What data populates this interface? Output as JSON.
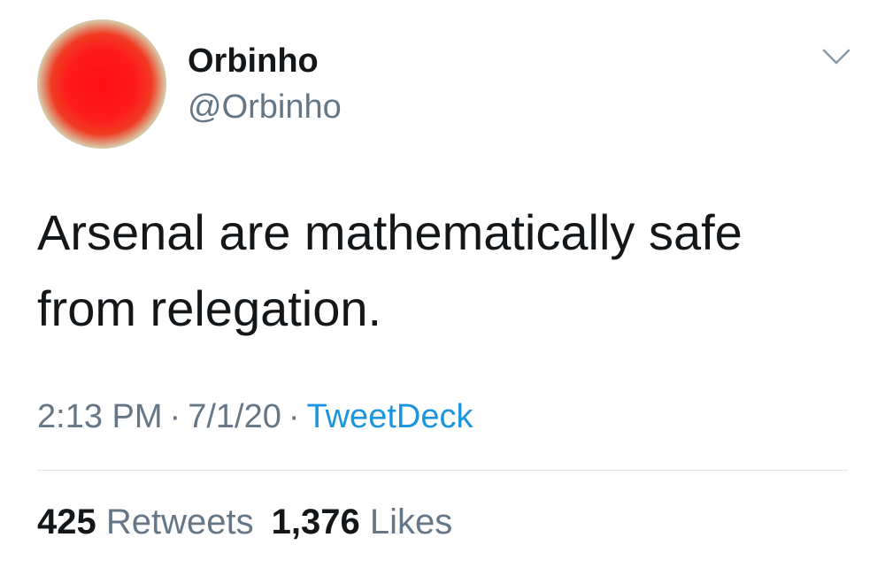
{
  "user": {
    "display_name": "Orbinho",
    "handle": "@Orbinho"
  },
  "tweet": {
    "text": "Arsenal are mathematically safe from relegation.",
    "time": "2:13 PM",
    "date": "7/1/20",
    "source": "TweetDeck",
    "separator": "·"
  },
  "stats": {
    "retweets_count": "425",
    "retweets_label": "Retweets",
    "likes_count": "1,376",
    "likes_label": "Likes"
  },
  "colors": {
    "text": "#14171a",
    "secondary": "#657786",
    "link": "#1b95e0",
    "divider": "#e1e8ed"
  },
  "icons": {
    "menu": "chevron-down-icon",
    "avatar": "red-circle-avatar"
  }
}
